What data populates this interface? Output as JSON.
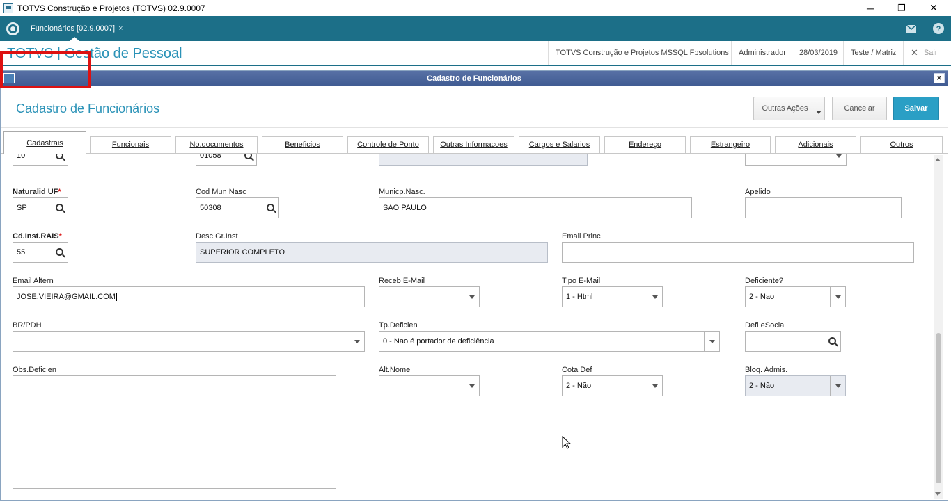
{
  "window": {
    "title": "TOTVS Construção e Projetos (TOTVS) 02.9.0007",
    "minimize": "─",
    "restore": "❐",
    "close": "✕"
  },
  "apptab": {
    "label": "Funcionários [02.9.0007]",
    "close": "×"
  },
  "header": {
    "brand": "TOTVS | Gestão de Pessoal",
    "company": "TOTVS Construção e Projetos MSSQL Fbsolutions",
    "user": "Administrador",
    "date": "28/03/2019",
    "branch": "Teste / Matriz",
    "logout": "Sair",
    "logout_icon": "✕"
  },
  "dialog": {
    "title": "Cadastro de Funcionários",
    "close": "×"
  },
  "form": {
    "title": "Cadastro de Funcionários",
    "other_actions": "Outras Ações",
    "cancel": "Cancelar",
    "save": "Salvar"
  },
  "tabs": [
    "Cadastrais",
    "Funcionais",
    "No.documentos",
    "Beneficios",
    "Controle de Ponto",
    "Outras Informacoes",
    "Cargos e Salarios",
    "Endereço",
    "Estrangeiro",
    "Adicionais",
    "Outros"
  ],
  "fields": {
    "row0_a": "10",
    "row0_b": "01058",
    "naturalid_uf": {
      "label": "Naturalid UF",
      "value": "SP"
    },
    "cod_mun_nasc": {
      "label": "Cod Mun Nasc",
      "value": "50308"
    },
    "municp_nasc": {
      "label": "Municp.Nasc.",
      "value": "SAO PAULO"
    },
    "apelido": {
      "label": "Apelido",
      "value": ""
    },
    "cd_inst_rais": {
      "label": "Cd.Inst.RAIS",
      "value": "55"
    },
    "desc_gr_inst": {
      "label": "Desc.Gr.Inst",
      "value": "SUPERIOR COMPLETO"
    },
    "email_princ": {
      "label": "Email Princ",
      "value": ""
    },
    "email_altern": {
      "label": "Email Altern",
      "value": "JOSE.VIEIRA@GMAIL.COM"
    },
    "receb_email": {
      "label": "Receb E-Mail",
      "value": ""
    },
    "tipo_email": {
      "label": "Tipo E-Mail",
      "value": "1 - Html"
    },
    "deficiente": {
      "label": "Deficiente?",
      "value": "2 - Nao"
    },
    "br_pdh": {
      "label": "BR/PDH",
      "value": ""
    },
    "tp_deficien": {
      "label": "Tp.Deficien",
      "value": "0 - Nao é portador de deficiência"
    },
    "defi_esocial": {
      "label": "Defi eSocial",
      "value": ""
    },
    "obs_deficien": {
      "label": "Obs.Deficien",
      "value": ""
    },
    "alt_nome": {
      "label": "Alt.Nome",
      "value": ""
    },
    "cota_def": {
      "label": "Cota Def",
      "value": "2 - Não"
    },
    "bloq_admis": {
      "label": "Bloq. Admis.",
      "value": "2 - Não"
    }
  },
  "required_marker": "*",
  "colors": {
    "tabbar": "#1c6f88",
    "brand": "#2a92b7",
    "primary_button": "#2a9fc5",
    "highlight": "#dd1111"
  }
}
